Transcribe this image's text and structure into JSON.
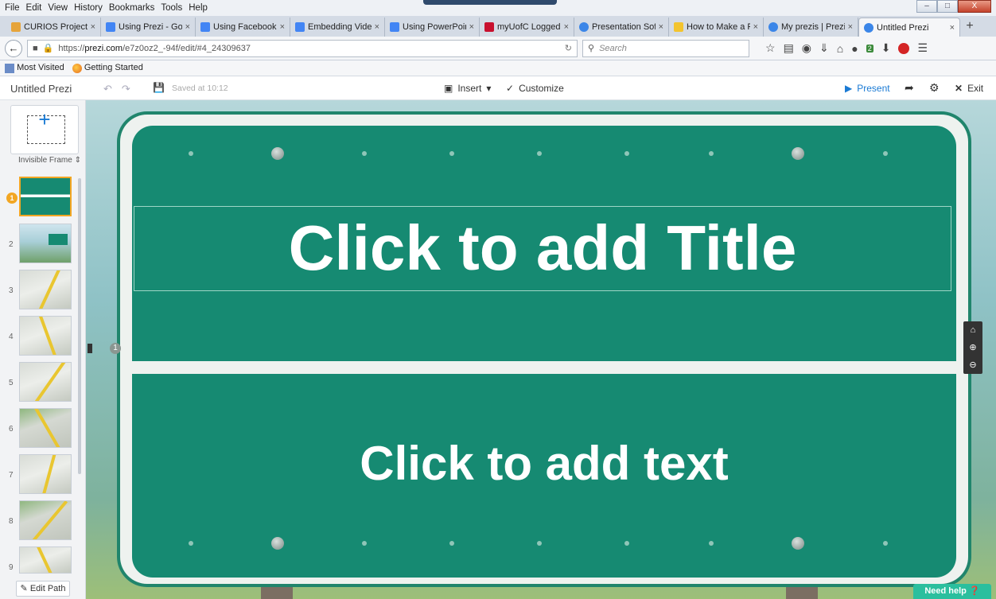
{
  "browser": {
    "menu": [
      "File",
      "Edit",
      "View",
      "History",
      "Bookmarks",
      "Tools",
      "Help"
    ],
    "tabs": [
      {
        "label": "CURIOS Project - ...",
        "color": "#e6a43b"
      },
      {
        "label": "Using Prezi - Goo...",
        "color": "#4285f4"
      },
      {
        "label": "Using Facebook -...",
        "color": "#4285f4"
      },
      {
        "label": "Embedding Video...",
        "color": "#4285f4"
      },
      {
        "label": "Using PowerPoint...",
        "color": "#4285f4"
      },
      {
        "label": "myUofC Logged ...",
        "color": "#c8102e"
      },
      {
        "label": "Presentation Soft...",
        "color": "#3b86e8"
      },
      {
        "label": "How to Make a Pr...",
        "color": "#f3c42e"
      },
      {
        "label": "My prezis | Prezi",
        "color": "#3b86e8"
      },
      {
        "label": "Untitled Prezi",
        "color": "#3b86e8"
      }
    ],
    "tab_close": "×",
    "newtab": "+",
    "url_prefix": "https://",
    "url_host": "prezi.com",
    "url_path": "/e7z0oz2_-94f/edit/#4_24309637",
    "search_placeholder": "Search",
    "bookmarks": [
      "Most Visited",
      "Getting Started"
    ],
    "win": {
      "min": "–",
      "max": "□",
      "close": "X"
    },
    "green_badge": "2"
  },
  "app": {
    "doc_title": "Untitled Prezi",
    "saved_label": "Saved at 10:12",
    "insert_label": "Insert",
    "customize_label": "Customize",
    "present_label": "Present",
    "exit_label": "Exit",
    "frame_type": "Invisible Frame",
    "edit_path_label": "Edit Path",
    "need_help_label": "Need help",
    "thumb_numbers": [
      "1",
      "2",
      "3",
      "4",
      "5",
      "6",
      "7",
      "8",
      "9"
    ],
    "frame_marker": "1"
  },
  "slide": {
    "title": "Click to add Title",
    "body": "Click to add text",
    "sign_color": "#168a72"
  }
}
